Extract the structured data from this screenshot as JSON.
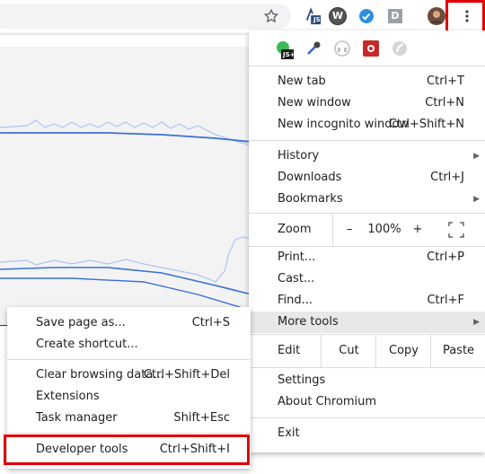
{
  "toolbar": {
    "ext_js_label": "JS",
    "ext_w_label": "W",
    "ext_d_label": "D"
  },
  "extensions": {
    "js_plus_label": "JS+"
  },
  "menu": {
    "new_tab": {
      "label": "New tab",
      "shortcut": "Ctrl+T"
    },
    "new_window": {
      "label": "New window",
      "shortcut": "Ctrl+N"
    },
    "new_incognito": {
      "label": "New incognito window",
      "shortcut": "Ctrl+Shift+N"
    },
    "history": {
      "label": "History"
    },
    "downloads": {
      "label": "Downloads",
      "shortcut": "Ctrl+J"
    },
    "bookmarks": {
      "label": "Bookmarks"
    },
    "zoom": {
      "label": "Zoom",
      "minus": "–",
      "value": "100%",
      "plus": "+"
    },
    "print": {
      "label": "Print...",
      "shortcut": "Ctrl+P"
    },
    "cast": {
      "label": "Cast..."
    },
    "find": {
      "label": "Find...",
      "shortcut": "Ctrl+F"
    },
    "more_tools": {
      "label": "More tools"
    },
    "edit": {
      "label": "Edit",
      "cut": "Cut",
      "copy": "Copy",
      "paste": "Paste"
    },
    "settings": {
      "label": "Settings"
    },
    "about": {
      "label": "About Chromium"
    },
    "exit": {
      "label": "Exit"
    }
  },
  "submenu": {
    "save_page": {
      "label": "Save page as...",
      "shortcut": "Ctrl+S"
    },
    "create_shortcut": {
      "label": "Create shortcut..."
    },
    "clear_data": {
      "label": "Clear browsing data...",
      "shortcut": "Ctrl+Shift+Del"
    },
    "extensions": {
      "label": "Extensions"
    },
    "task_manager": {
      "label": "Task manager",
      "shortcut": "Shift+Esc"
    },
    "developer_tools": {
      "label": "Developer tools",
      "shortcut": "Ctrl+Shift+I"
    }
  },
  "colors": {
    "highlight": "#e00000",
    "chart_line_dark": "#3b6fd6",
    "chart_line_light": "#aac4f2"
  }
}
